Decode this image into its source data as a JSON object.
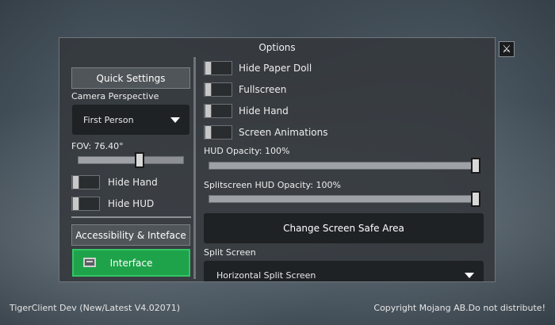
{
  "panel": {
    "title": "Options",
    "close_icon": "crossed-swords-icon"
  },
  "left": {
    "quick_settings_label": "Quick Settings",
    "camera_label": "Camera Perspective",
    "camera_value": "First Person",
    "fov_label": "FOV: 76.40°",
    "fov_fraction": 0.58,
    "hide_hand_label": "Hide Hand",
    "hide_hud_label": "Hide HUD",
    "accessibility_label": "Accessibility & Inteface",
    "interface_label": "Interface"
  },
  "right": {
    "toggles": [
      {
        "label": "Hide Paper Doll",
        "on": false
      },
      {
        "label": "Fullscreen",
        "on": false
      },
      {
        "label": "Hide Hand",
        "on": false
      },
      {
        "label": "Screen Animations",
        "on": false
      }
    ],
    "hud_opacity_label": "HUD Opacity: 100%",
    "hud_opacity_value": 1.0,
    "split_hud_opacity_label": "Splitscreen HUD Opacity: 100%",
    "split_hud_opacity_value": 1.0,
    "safe_area_label": "Change Screen Safe Area",
    "split_screen_label": "Split Screen",
    "split_screen_value": "Horizontal Split Screen"
  },
  "footer": {
    "version": "TigerClient Dev (New/Latest V4.02071)",
    "copyright": "Copyright Mojang AB.Do not distribute!"
  },
  "colors": {
    "accent_green": "#1fa34a",
    "panel_bg": "#34383c"
  }
}
